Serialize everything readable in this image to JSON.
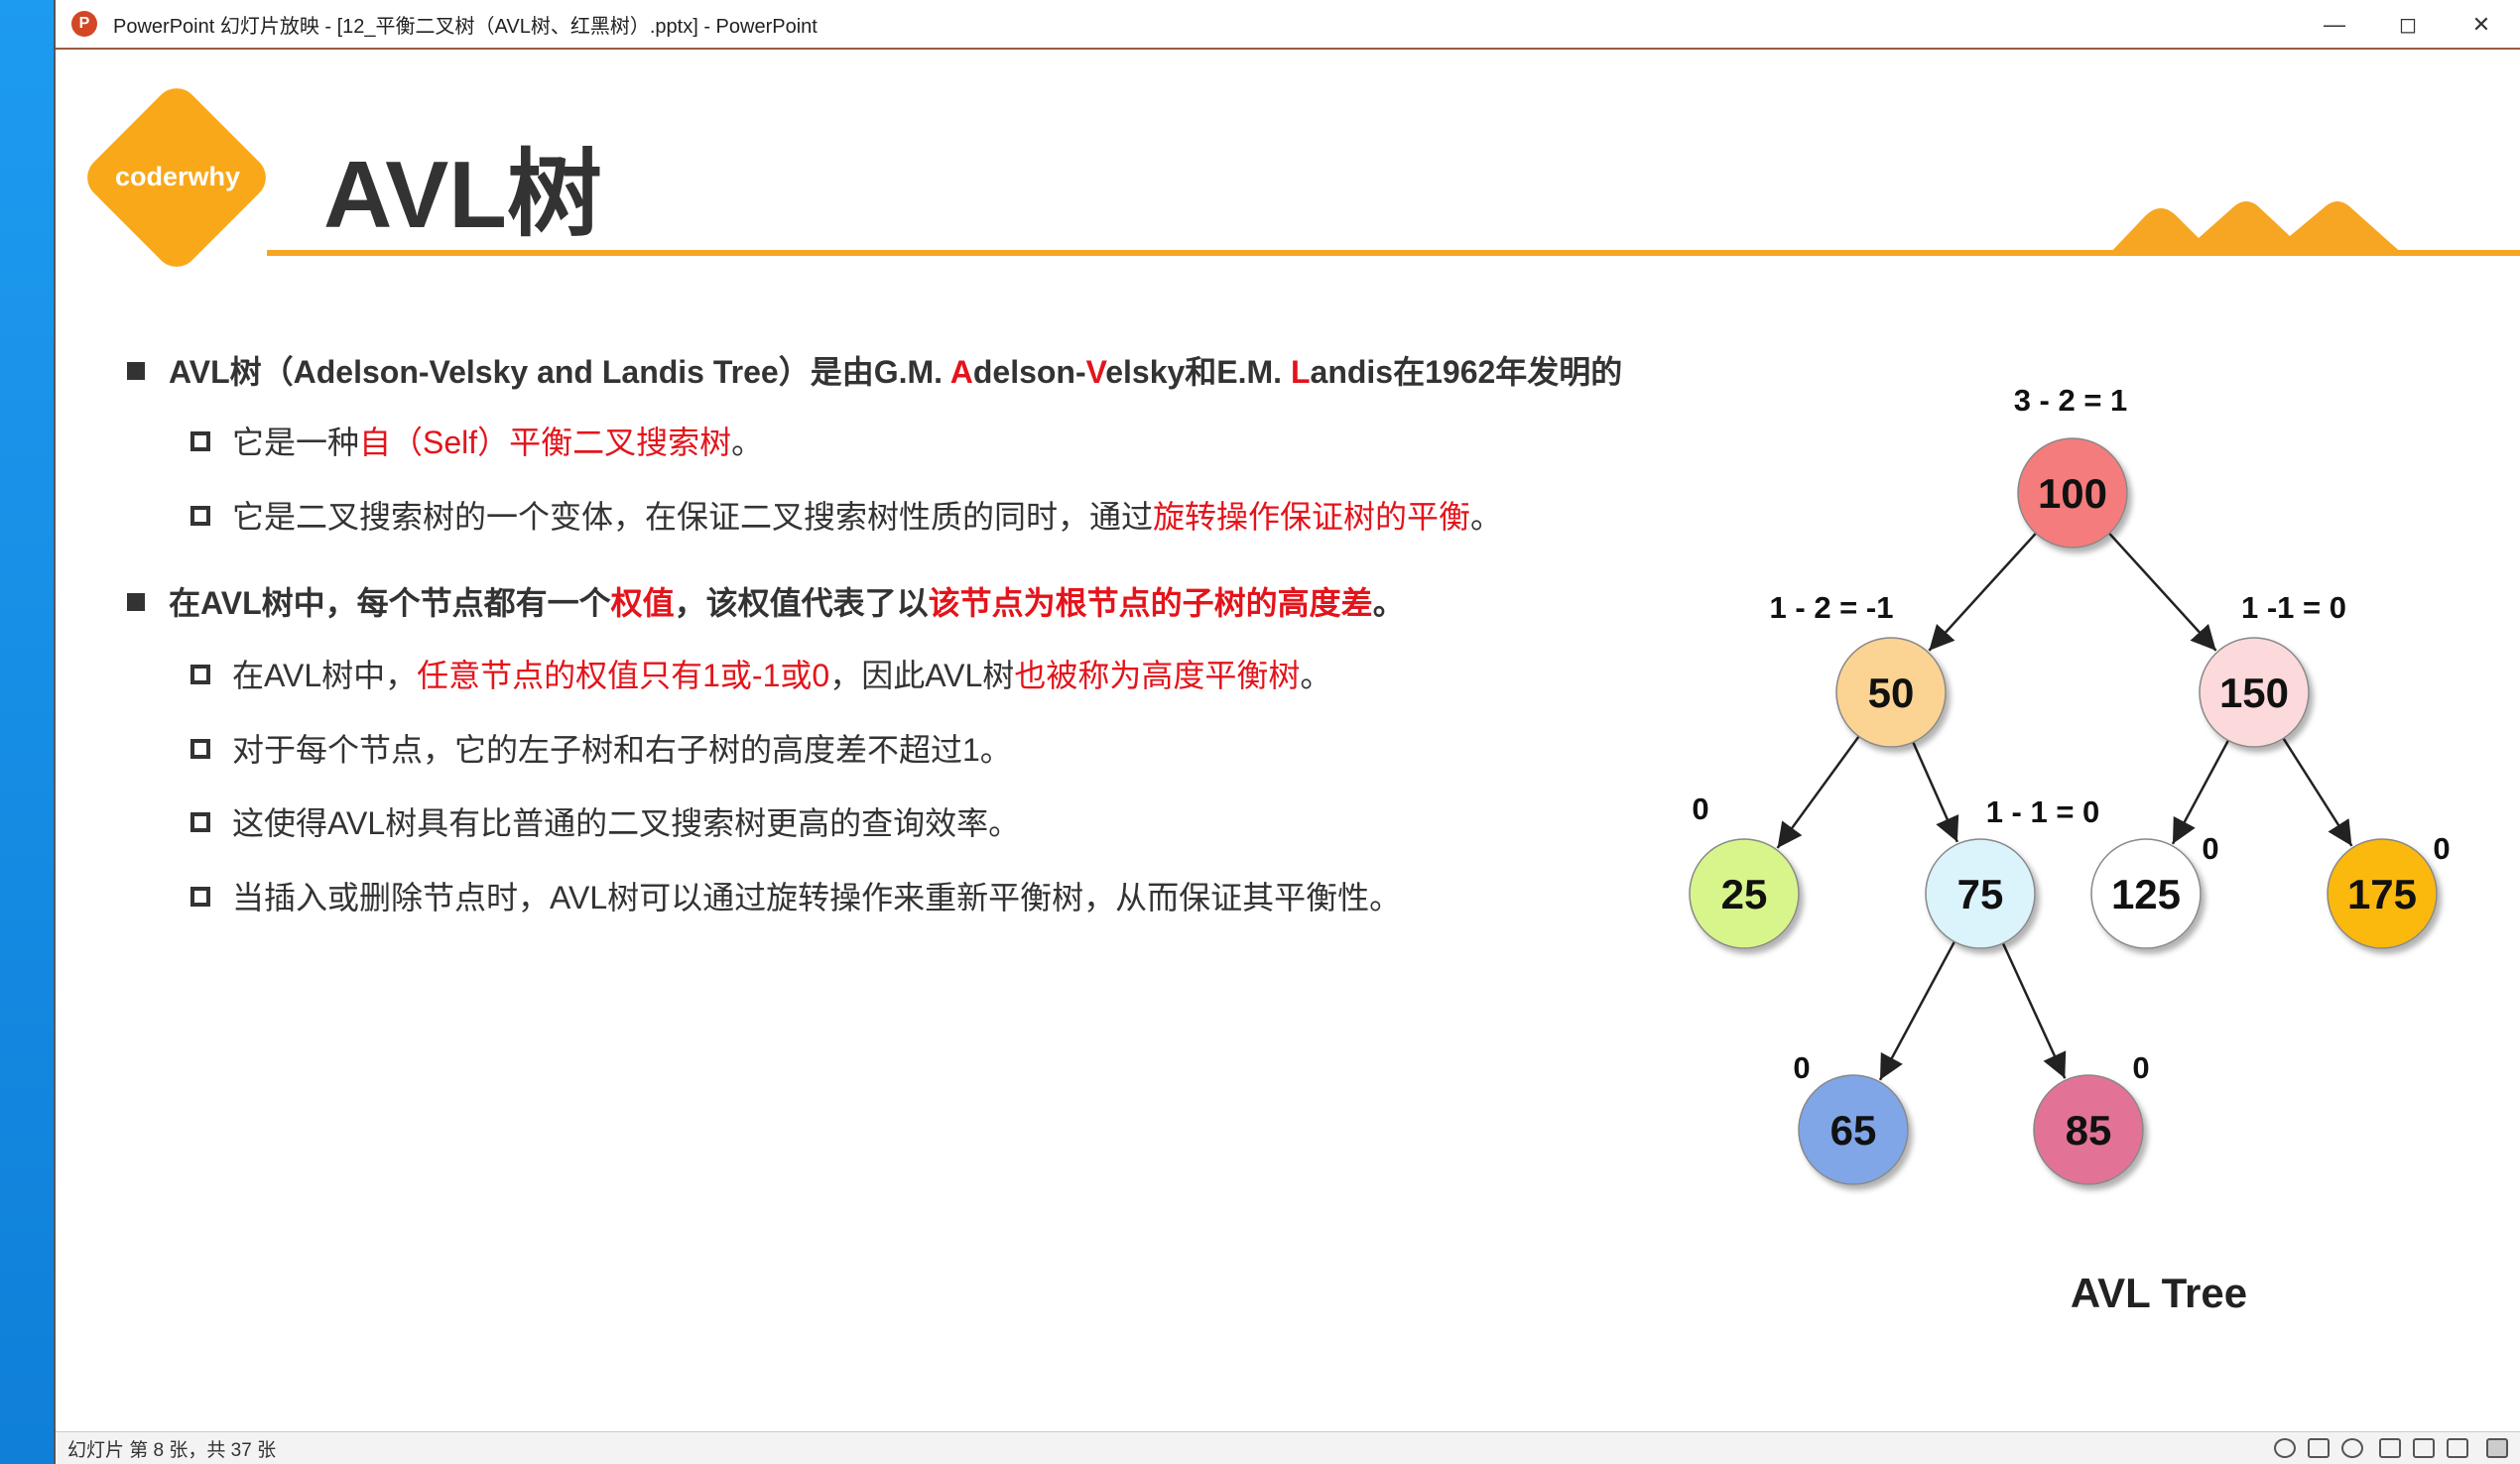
{
  "window": {
    "title": "PowerPoint 幻灯片放映 - [12_平衡二叉树（AVL树、红黑树）.pptx] - PowerPoint",
    "app_icon": "P"
  },
  "slide": {
    "logo": "coderwhy",
    "title": "AVL树",
    "bullets": [
      {
        "level": 1,
        "segments": [
          {
            "t": "AVL树（Adelson-Velsky and Landis Tree）是由G.M. "
          },
          {
            "t": "A",
            "red": true
          },
          {
            "t": "delson-"
          },
          {
            "t": "V",
            "red": true
          },
          {
            "t": "elsky和E.M. "
          },
          {
            "t": "L",
            "red": true
          },
          {
            "t": "andis在1962年发明的"
          }
        ]
      },
      {
        "level": 2,
        "segments": [
          {
            "t": "它是一种"
          },
          {
            "t": "自（Self）平衡二叉搜索树",
            "red": true
          },
          {
            "t": "。"
          }
        ]
      },
      {
        "level": 2,
        "segments": [
          {
            "t": "它是二叉搜索树的一个变体，在保证二叉搜索树性质的同时，通过"
          },
          {
            "t": "旋转操作保证树的平衡",
            "red": true
          },
          {
            "t": "。"
          }
        ]
      },
      {
        "level": 1,
        "segments": [
          {
            "t": "在AVL树中，每个节点都有一个"
          },
          {
            "t": "权值",
            "red": true
          },
          {
            "t": "，该权值代表了以"
          },
          {
            "t": "该节点为根节点的子树的高度差",
            "red": true
          },
          {
            "t": "。"
          }
        ]
      },
      {
        "level": 2,
        "segments": [
          {
            "t": "在AVL树中，"
          },
          {
            "t": "任意节点的权值只有1或-1或0",
            "red": true
          },
          {
            "t": "，因此AVL树"
          },
          {
            "t": "也被称为高度平衡树",
            "red": true
          },
          {
            "t": "。"
          }
        ]
      },
      {
        "level": 2,
        "segments": [
          {
            "t": "对于每个节点，它的左子树和右子树的高度差不超过1。"
          }
        ]
      },
      {
        "level": 2,
        "segments": [
          {
            "t": "这使得AVL树具有比普通的二叉搜索树更高的查询效率。"
          }
        ]
      },
      {
        "level": 2,
        "segments": [
          {
            "t": "当插入或删除节点时，AVL树可以通过旋转操作来重新平衡树，从而保证其平衡性。"
          }
        ]
      }
    ],
    "tree": {
      "caption": "AVL Tree",
      "nodes": [
        {
          "value": "100",
          "balance": "3 - 2 = 1",
          "color": "#f47c7c"
        },
        {
          "value": "50",
          "balance": "1 - 2 = -1",
          "color": "#fbd393"
        },
        {
          "value": "150",
          "balance": "1 -1 = 0",
          "color": "#fcd9da"
        },
        {
          "value": "25",
          "balance": "0",
          "color": "#d8f58c"
        },
        {
          "value": "75",
          "balance": "1 - 1 = 0",
          "color": "#dbf3fb"
        },
        {
          "value": "125",
          "balance": "0",
          "color": "#ffffff"
        },
        {
          "value": "175",
          "balance": "0",
          "color": "#fbb811"
        },
        {
          "value": "65",
          "balance": "0",
          "color": "#80a6e8"
        },
        {
          "value": "85",
          "balance": "0",
          "color": "#e27397"
        }
      ],
      "edges": [
        [
          "100",
          "50"
        ],
        [
          "100",
          "150"
        ],
        [
          "50",
          "25"
        ],
        [
          "50",
          "75"
        ],
        [
          "150",
          "125"
        ],
        [
          "150",
          "175"
        ],
        [
          "75",
          "65"
        ],
        [
          "75",
          "85"
        ]
      ]
    }
  },
  "status": {
    "slide_count": "幻灯片 第 8 张，共 37 张"
  },
  "colors": {
    "accent": "#f6a623",
    "highlight": "#e3141b"
  }
}
